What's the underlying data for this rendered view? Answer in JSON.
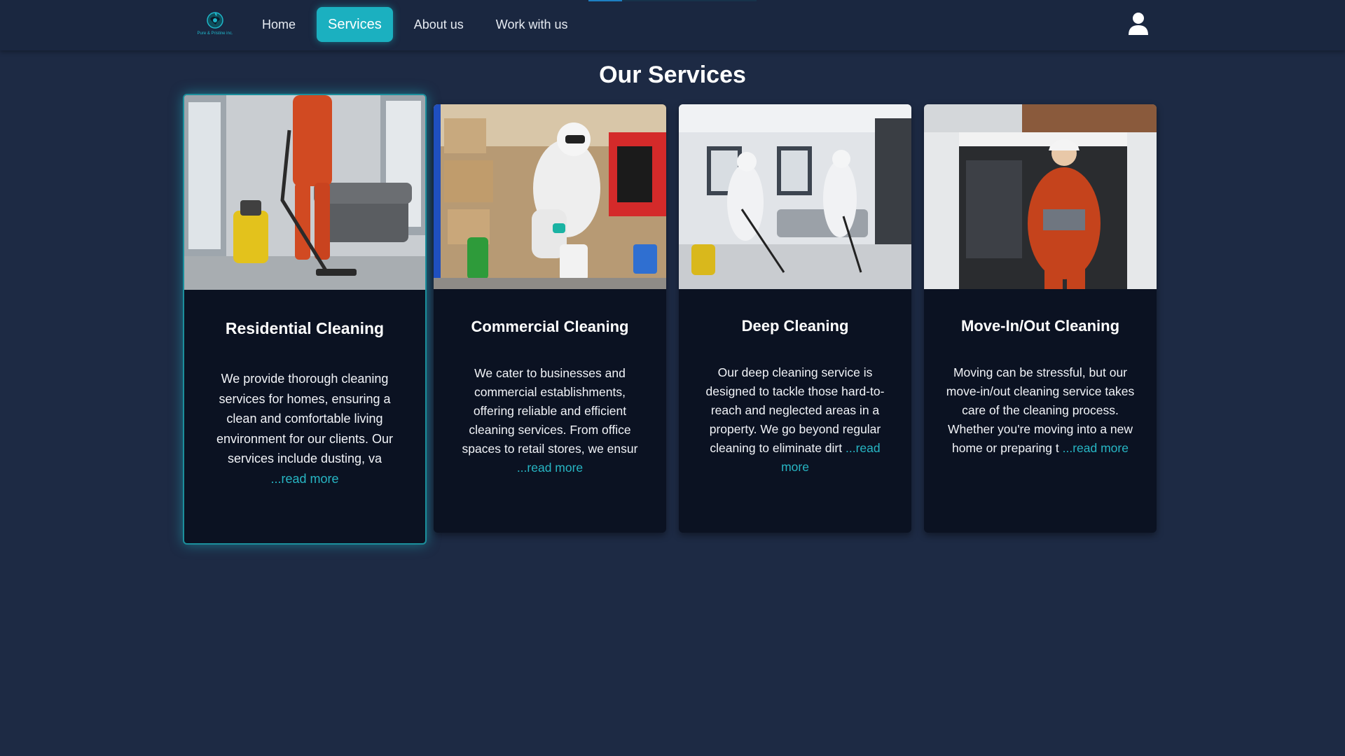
{
  "nav": {
    "logo_text": "Pure & Pristine inc.",
    "links": [
      "Home",
      "Services",
      "About us",
      "Work with us"
    ],
    "active": "Services"
  },
  "page": {
    "title": "Our Services"
  },
  "cards": [
    {
      "title": "Residential Cleaning",
      "text": "We provide thorough cleaning services for homes, ensuring a clean and comfortable living environment for our clients. Our services include dusting, va",
      "read_more": "...read more"
    },
    {
      "title": "Commercial Cleaning",
      "text": "We cater to businesses and commercial establishments, offering reliable and efficient cleaning services. From office spaces to retail stores, we ensur",
      "read_more": "...read more"
    },
    {
      "title": "Deep Cleaning",
      "text": "Our deep cleaning service is designed to tackle those hard-to-reach and neglected areas in a property. We go beyond regular cleaning to eliminate dirt",
      "read_more": "...read more"
    },
    {
      "title": "Move-In/Out Cleaning",
      "text": "Moving can be stressful, but our move-in/out cleaning service takes care of the cleaning process. Whether you're moving into a new home or preparing t",
      "read_more": "...read more"
    }
  ],
  "colors": {
    "background": "#1d2a44",
    "navbar": "#1a2740",
    "accent": "#1bb0c0",
    "card": "#0b1222",
    "link": "#27b6c4"
  },
  "icons": {
    "logo": "globe-leaf-logo",
    "user": "user-icon"
  }
}
